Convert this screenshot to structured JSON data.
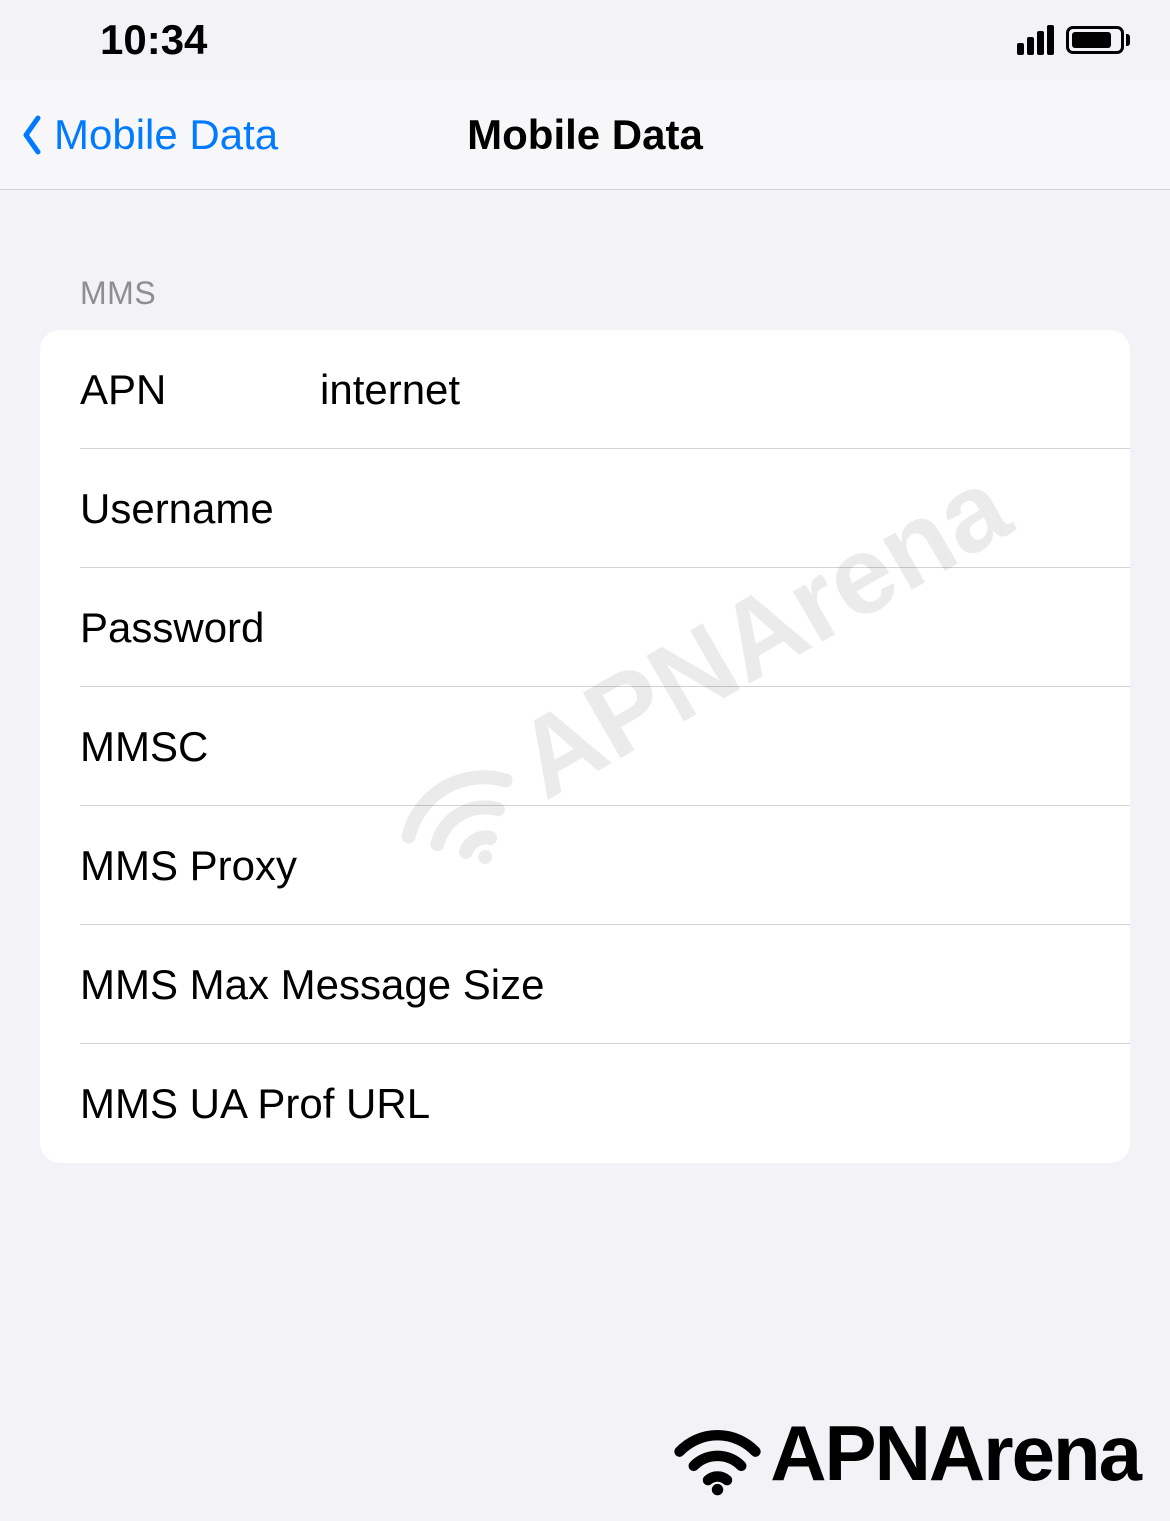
{
  "statusbar": {
    "time": "10:34"
  },
  "nav": {
    "back_label": "Mobile Data",
    "title": "Mobile Data"
  },
  "section": {
    "header": "MMS",
    "rows": [
      {
        "label": "APN",
        "value": "internet"
      },
      {
        "label": "Username",
        "value": ""
      },
      {
        "label": "Password",
        "value": ""
      },
      {
        "label": "MMSC",
        "value": ""
      },
      {
        "label": "MMS Proxy",
        "value": ""
      },
      {
        "label": "MMS Max Message Size",
        "value": ""
      },
      {
        "label": "MMS UA Prof URL",
        "value": ""
      }
    ]
  },
  "watermark": {
    "text": "APNArena"
  },
  "brand": {
    "text": "APNArena"
  }
}
